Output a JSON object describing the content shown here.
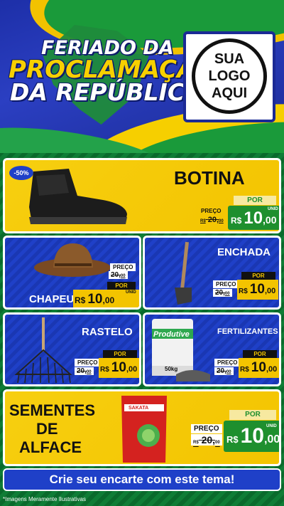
{
  "header": {
    "title_line1": "FERIADO DA",
    "title_line2": "PROCLAMAÇÃO",
    "title_line3": "DA REPÚBLICA",
    "logo_line1": "SUA",
    "logo_line2": "LOGO",
    "logo_line3": "AQUI"
  },
  "products": {
    "botina": {
      "name": "BOTINA",
      "badge": "-50%",
      "preco_label": "PREÇO",
      "por_label": "POR",
      "old_price": "20,",
      "old_cents": "00",
      "currency": "R$",
      "price_int": "10",
      "price_cents": ",00",
      "unit": "UNID",
      "icon": "boot-icon"
    },
    "chapeu": {
      "name": "CHAPEU",
      "preco_label": "PREÇO",
      "por_label": "POR",
      "old_price": "20,",
      "old_cents": "00",
      "currency": "R$",
      "price_int": "10",
      "price_cents": ",00",
      "unit": "UNID",
      "icon": "hat-icon"
    },
    "enchada": {
      "name": "ENCHADA",
      "preco_label": "PREÇO",
      "por_label": "POR",
      "old_price": "20,",
      "old_cents": "00",
      "currency": "R$",
      "price_int": "10",
      "price_cents": ",00",
      "unit": "UNID",
      "icon": "hoe-icon"
    },
    "rastelo": {
      "name": "RASTELO",
      "preco_label": "PREÇO",
      "por_label": "POR",
      "old_price": "20,",
      "old_cents": "00",
      "currency": "R$",
      "price_int": "10",
      "price_cents": ",00",
      "unit": "UNID",
      "icon": "rake-icon"
    },
    "fertilizantes": {
      "name": "FERTILIZANTES",
      "bag_label": "Produtive",
      "bag_weight": "50kg",
      "preco_label": "PREÇO",
      "por_label": "POR",
      "old_price": "20,",
      "old_cents": "00",
      "currency": "R$",
      "price_int": "10",
      "price_cents": ",00",
      "unit": "UNID",
      "icon": "fertilizer-bag-icon"
    },
    "alface": {
      "name_line1": "SEMENTES",
      "name_line2": "DE",
      "name_line3": "ALFACE",
      "pack_brand": "SAKATA",
      "preco_label": "PREÇO",
      "por_label": "POR",
      "old_price": "20,",
      "old_cents": "00",
      "currency": "R$",
      "price_int": "10",
      "price_cents": ",00",
      "unit": "UNID",
      "icon": "seed-packet-icon"
    }
  },
  "cta": "Crie seu encarte com este tema!",
  "footnote": "*Imagens Meramente Ilustrativas",
  "colors": {
    "yellow": "#f3c400",
    "blue": "#1f40c8",
    "green": "#1a9a3a",
    "price_green": "#1e8f2e"
  }
}
